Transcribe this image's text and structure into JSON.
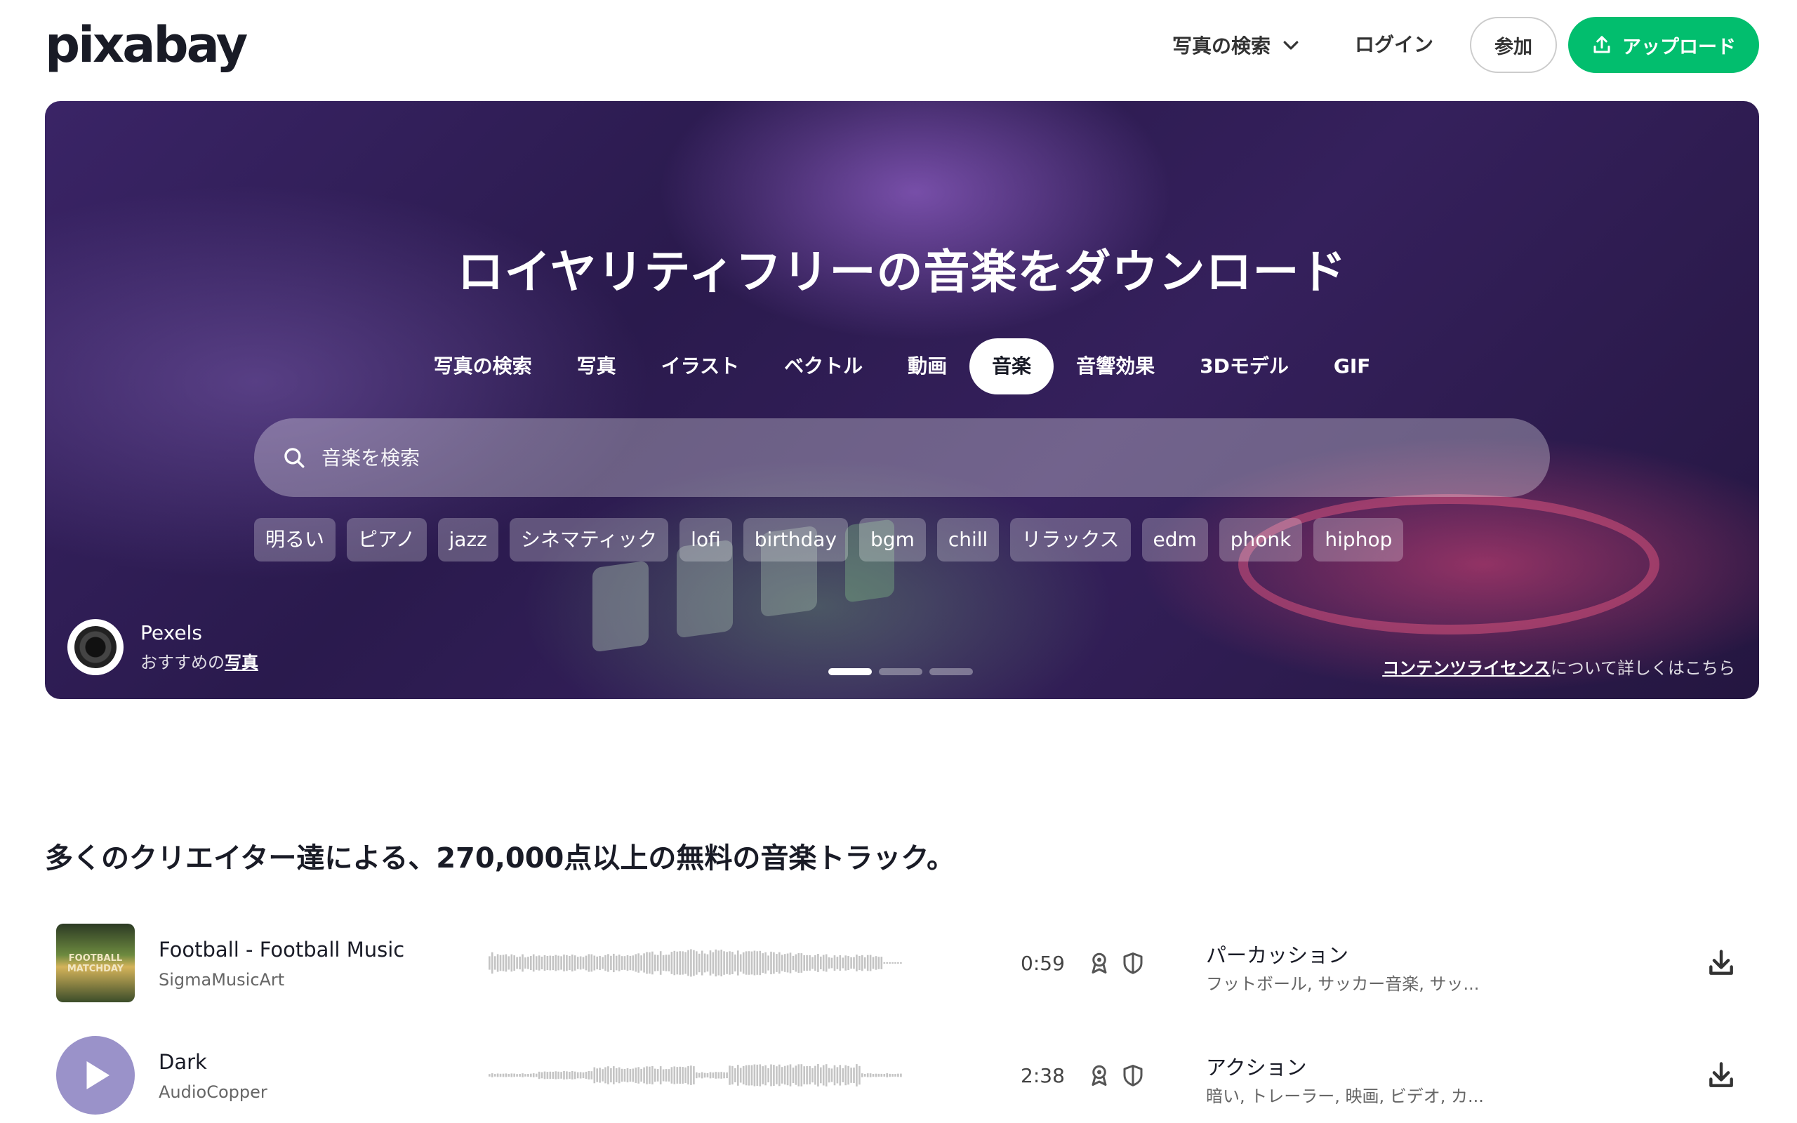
{
  "header": {
    "logo": "pixabay",
    "search_menu_label": "写真の検索",
    "login_label": "ログイン",
    "join_label": "参加",
    "upload_label": "アップロード",
    "accent_color": "#02be6e"
  },
  "hero": {
    "title": "ロイヤリティフリーの音楽をダウンロード",
    "tabs": [
      {
        "label": "写真の検索",
        "active": false
      },
      {
        "label": "写真",
        "active": false
      },
      {
        "label": "イラスト",
        "active": false
      },
      {
        "label": "ベクトル",
        "active": false
      },
      {
        "label": "動画",
        "active": false
      },
      {
        "label": "音楽",
        "active": true
      },
      {
        "label": "音響効果",
        "active": false
      },
      {
        "label": "3Dモデル",
        "active": false
      },
      {
        "label": "GIF",
        "active": false
      }
    ],
    "search_placeholder": "音楽を検索",
    "tags": [
      "明るい",
      "ピアノ",
      "jazz",
      "シネマティック",
      "lofi",
      "birthday",
      "bgm",
      "chill",
      "リラックス",
      "edm",
      "phonk",
      "hiphop"
    ],
    "credit": {
      "name": "Pexels",
      "prefix": "おすすめの",
      "link": "写真"
    },
    "carousel_slides": 3,
    "carousel_active": 1,
    "license": {
      "link": "コンテンツライセンス",
      "suffix": "について詳しくはこちら"
    }
  },
  "main": {
    "heading": "多くのクリエイター達による、270,000点以上の無料の音楽トラック。",
    "tracks": [
      {
        "title": "Football - Football Music",
        "artist": "SigmaMusicArt",
        "cover_text": "FOOTBALL MATCHDAY",
        "duration": "0:59",
        "genre": "パーカッション",
        "tags": "フットボール, サッカー音楽, サッ..."
      },
      {
        "title": "Dark",
        "artist": "AudioCopper",
        "duration": "2:38",
        "genre": "アクション",
        "tags": "暗い, トレーラー, 映画, ビデオ, カ..."
      }
    ]
  }
}
